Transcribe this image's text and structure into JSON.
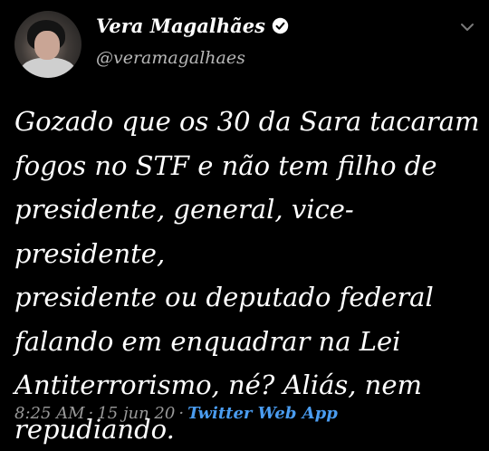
{
  "author": {
    "display_name": "Vera Magalhães",
    "handle": "@veramagalhaes"
  },
  "tweet": {
    "text": "Gozado que os 30 da Sara tacaram\nfogos no STF e não tem filho de\npresidente, general, vice-presidente,\npresidente ou deputado federal\nfalando em enquadrar na Lei\nAntiterrorismo, né? Aliás, nem\nrepudiando."
  },
  "meta": {
    "time": "8:25 AM",
    "separator": "·",
    "date": "15 jun 20",
    "app": "Twitter Web App"
  },
  "icons": {
    "verified": "verified-badge-icon",
    "caret": "chevron-down-icon"
  },
  "colors": {
    "background": "#000000",
    "link": "#4a9cf0",
    "secondary_text": "#9a9a9a"
  }
}
